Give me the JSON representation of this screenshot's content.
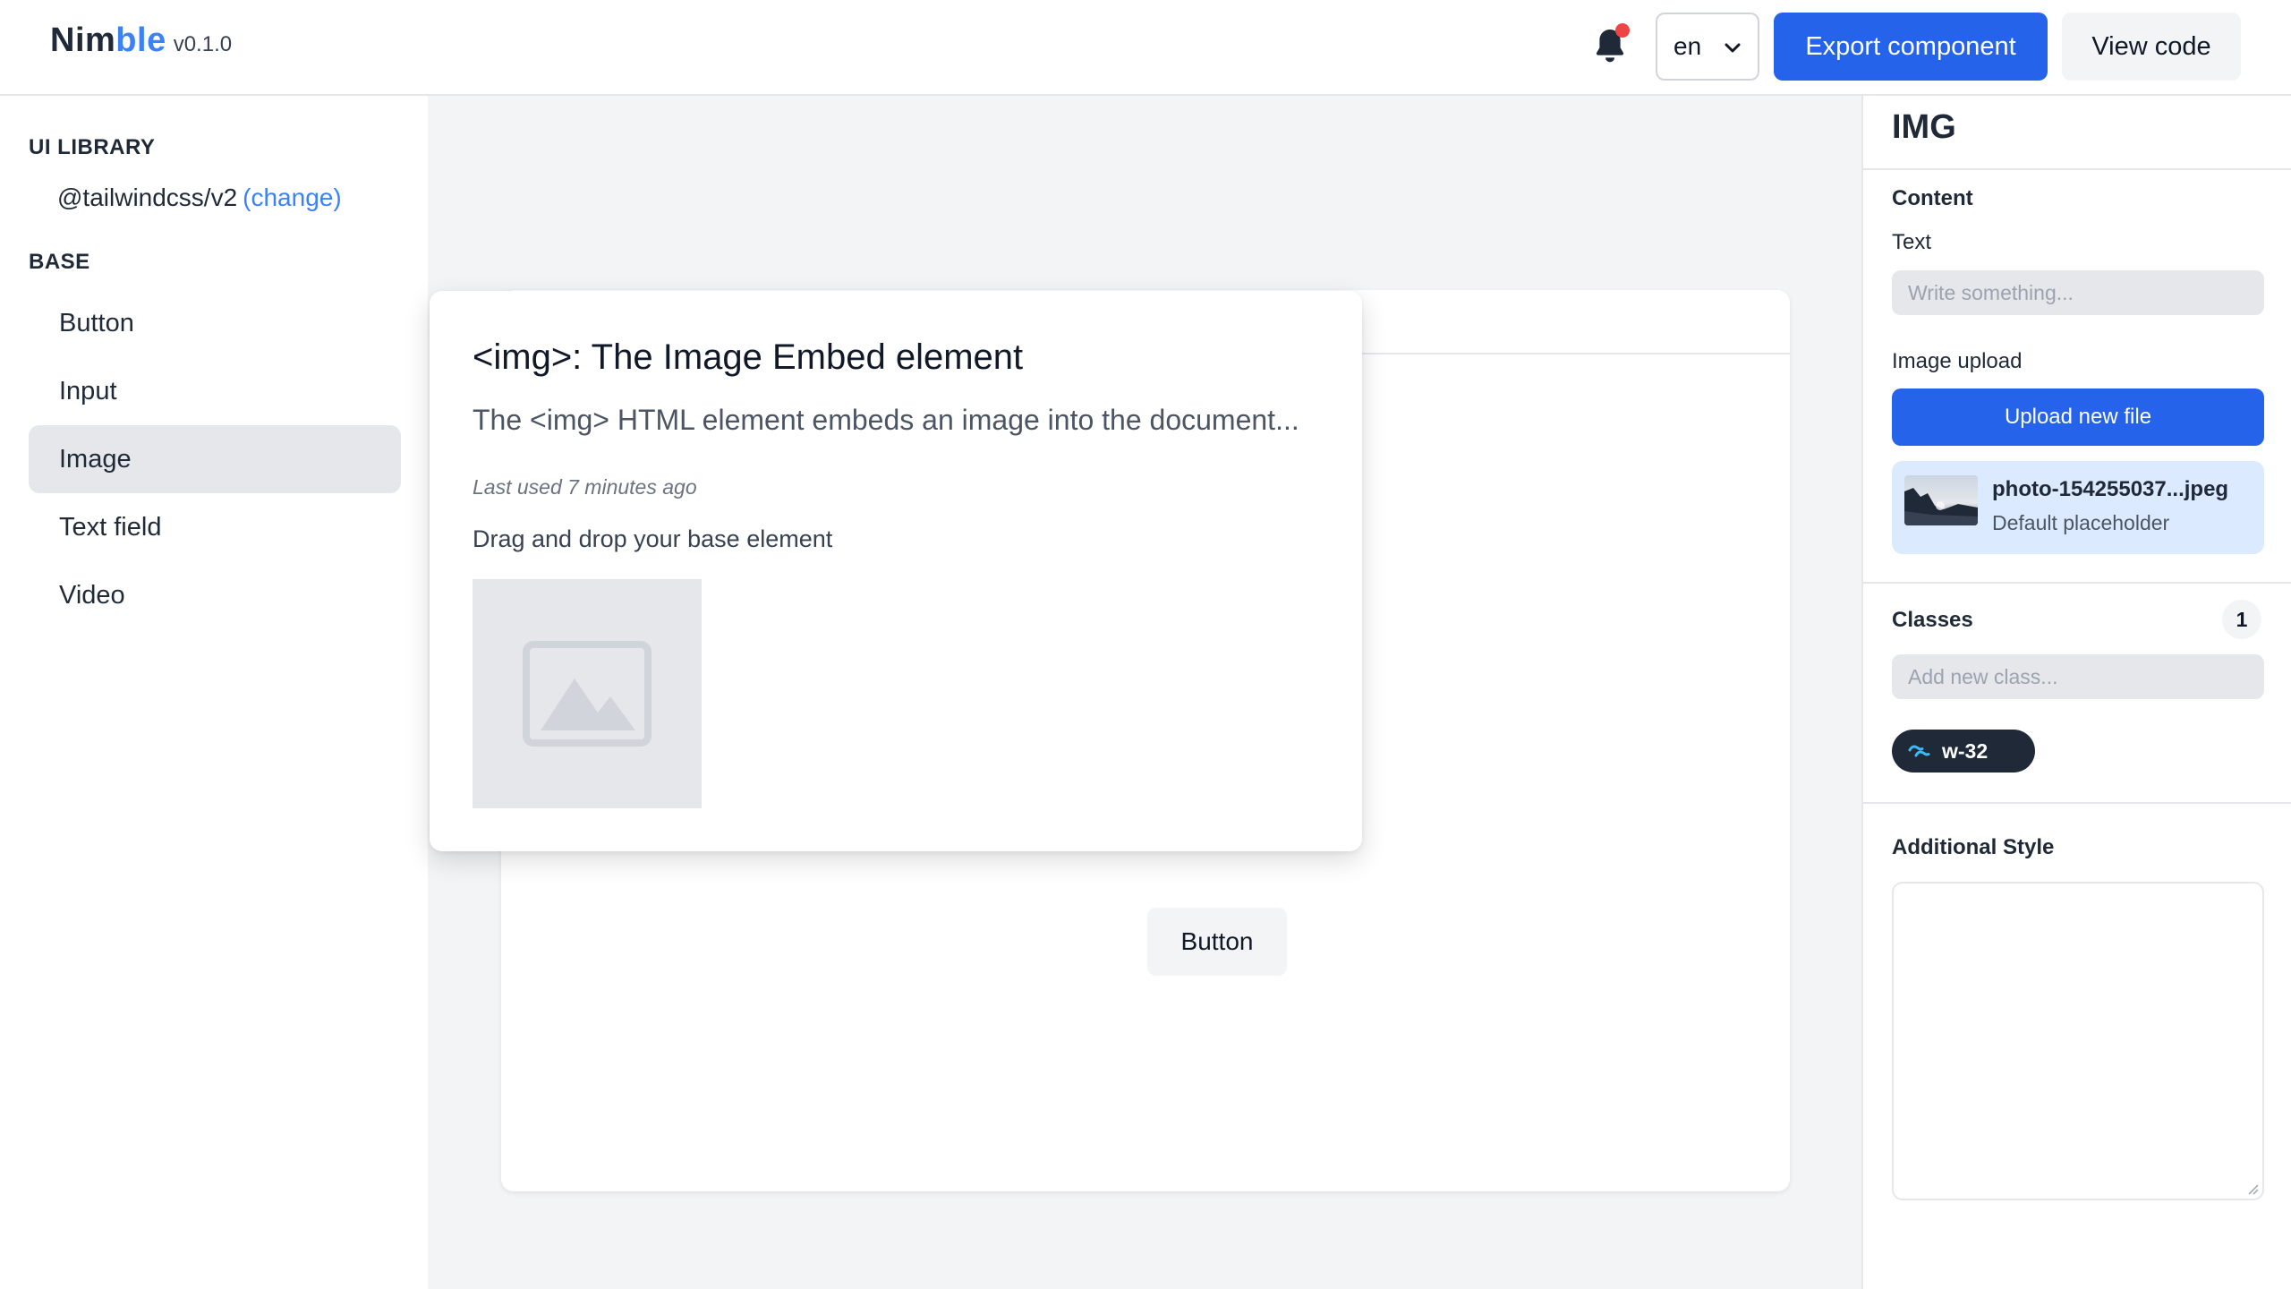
{
  "header": {
    "brand_prefix": "Nim",
    "brand_accent": "ble",
    "version": "v0.1.0",
    "notification_icon": "bell-icon",
    "language": "en",
    "export_label": "Export component",
    "view_code_label": "View code"
  },
  "sidebar": {
    "ui_library_title": "UI LIBRARY",
    "library_name": "@tailwindcss/v2",
    "change_label": "(change)",
    "base_title": "BASE",
    "items": [
      {
        "label": "Button",
        "active": false
      },
      {
        "label": "Input",
        "active": false
      },
      {
        "label": "Image",
        "active": true
      },
      {
        "label": "Text field",
        "active": false
      },
      {
        "label": "Video",
        "active": false
      }
    ]
  },
  "canvas": {
    "button_label": "Button"
  },
  "popover": {
    "title": "<img>: The Image Embed element",
    "description": "The <img> HTML element embeds an image into the document...",
    "last_used": "Last used 7 minutes ago",
    "hint": "Drag and drop your base element",
    "thumbnail_icon": "image-placeholder-icon"
  },
  "panel": {
    "title": "IMG",
    "content_title": "Content",
    "text_label": "Text",
    "text_placeholder": "Write something...",
    "image_upload_label": "Image upload",
    "upload_button": "Upload new file",
    "file_name": "photo-154255037...jpeg",
    "file_caption": "Default placeholder",
    "classes_title": "Classes",
    "classes_count": "1",
    "class_placeholder": "Add new class...",
    "class_chip": "w-32",
    "additional_style_title": "Additional Style"
  },
  "colors": {
    "primary": "#2563eb",
    "brand_accent": "#3b82f6",
    "notification_dot": "#ef4444",
    "active_nav": "#e5e7eb"
  }
}
